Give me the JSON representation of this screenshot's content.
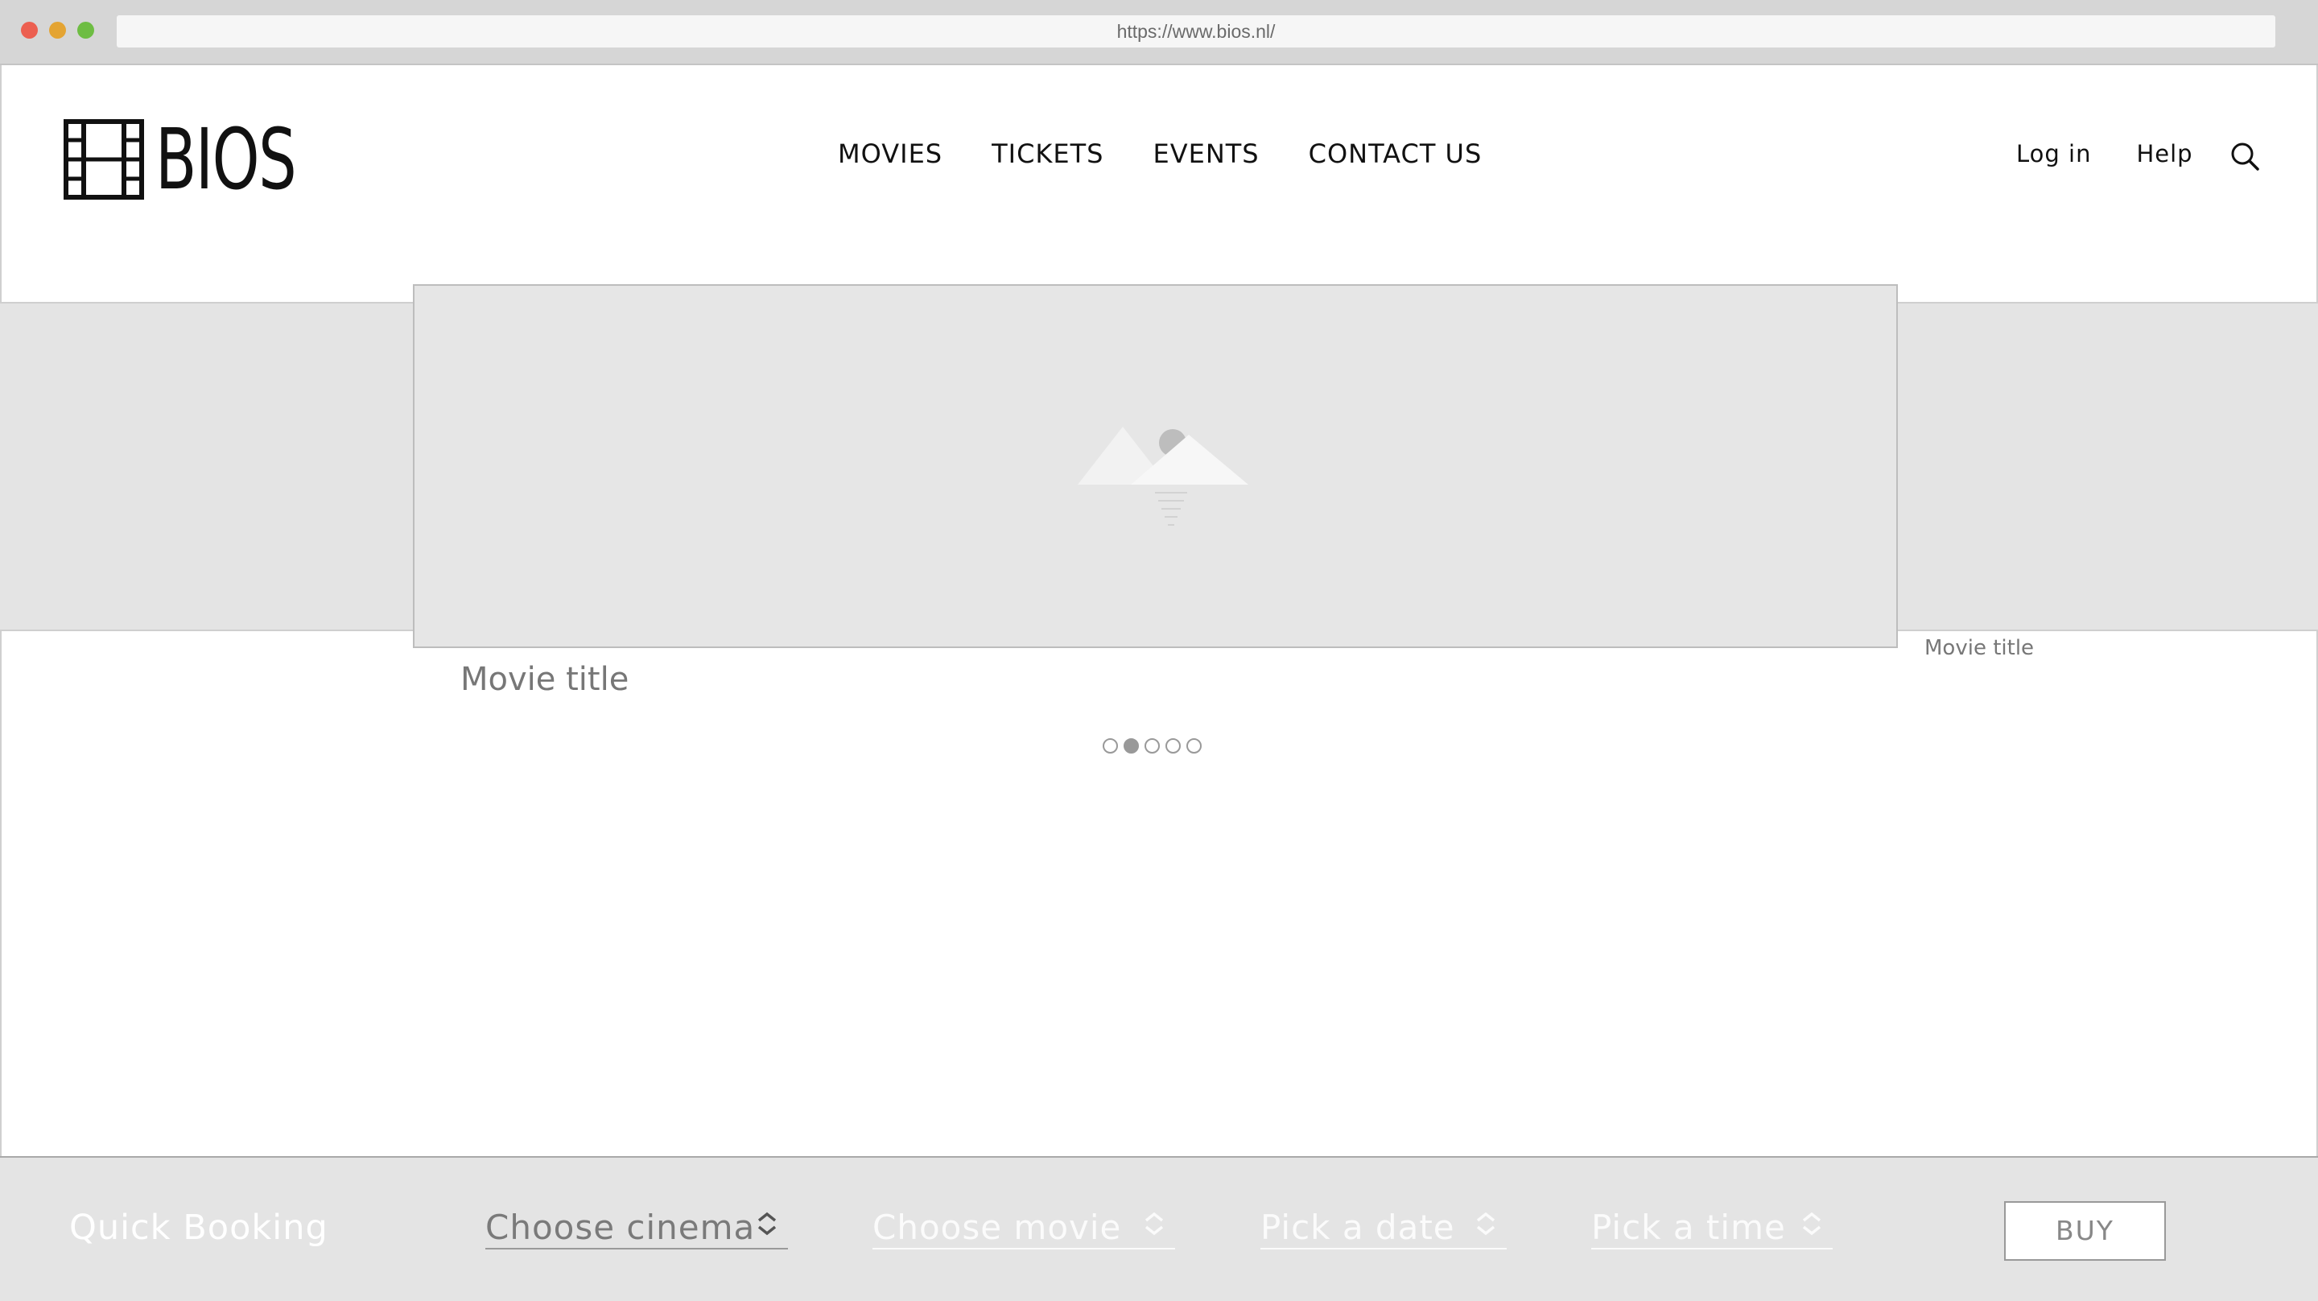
{
  "browser": {
    "url": "https://www.bios.nl/"
  },
  "header": {
    "logo_text": "BIOS",
    "nav": [
      "MOVIES",
      "TICKETS",
      "EVENTS",
      "CONTACT US"
    ],
    "login_label": "Log in",
    "help_label": "Help"
  },
  "carousel": {
    "title": "Movie title",
    "next_title": "Movie title",
    "slide_count": 5,
    "active_index": 1
  },
  "quick_booking": {
    "title": "Quick Booking",
    "cinema": "Choose cinema",
    "movie": "Choose movie",
    "date": "Pick a date",
    "time": "Pick a time",
    "buy_label": "BUY"
  },
  "colors": {
    "panel_grey": "#e4e4e4",
    "muted_text": "#777777",
    "active_dot": "#999999"
  }
}
